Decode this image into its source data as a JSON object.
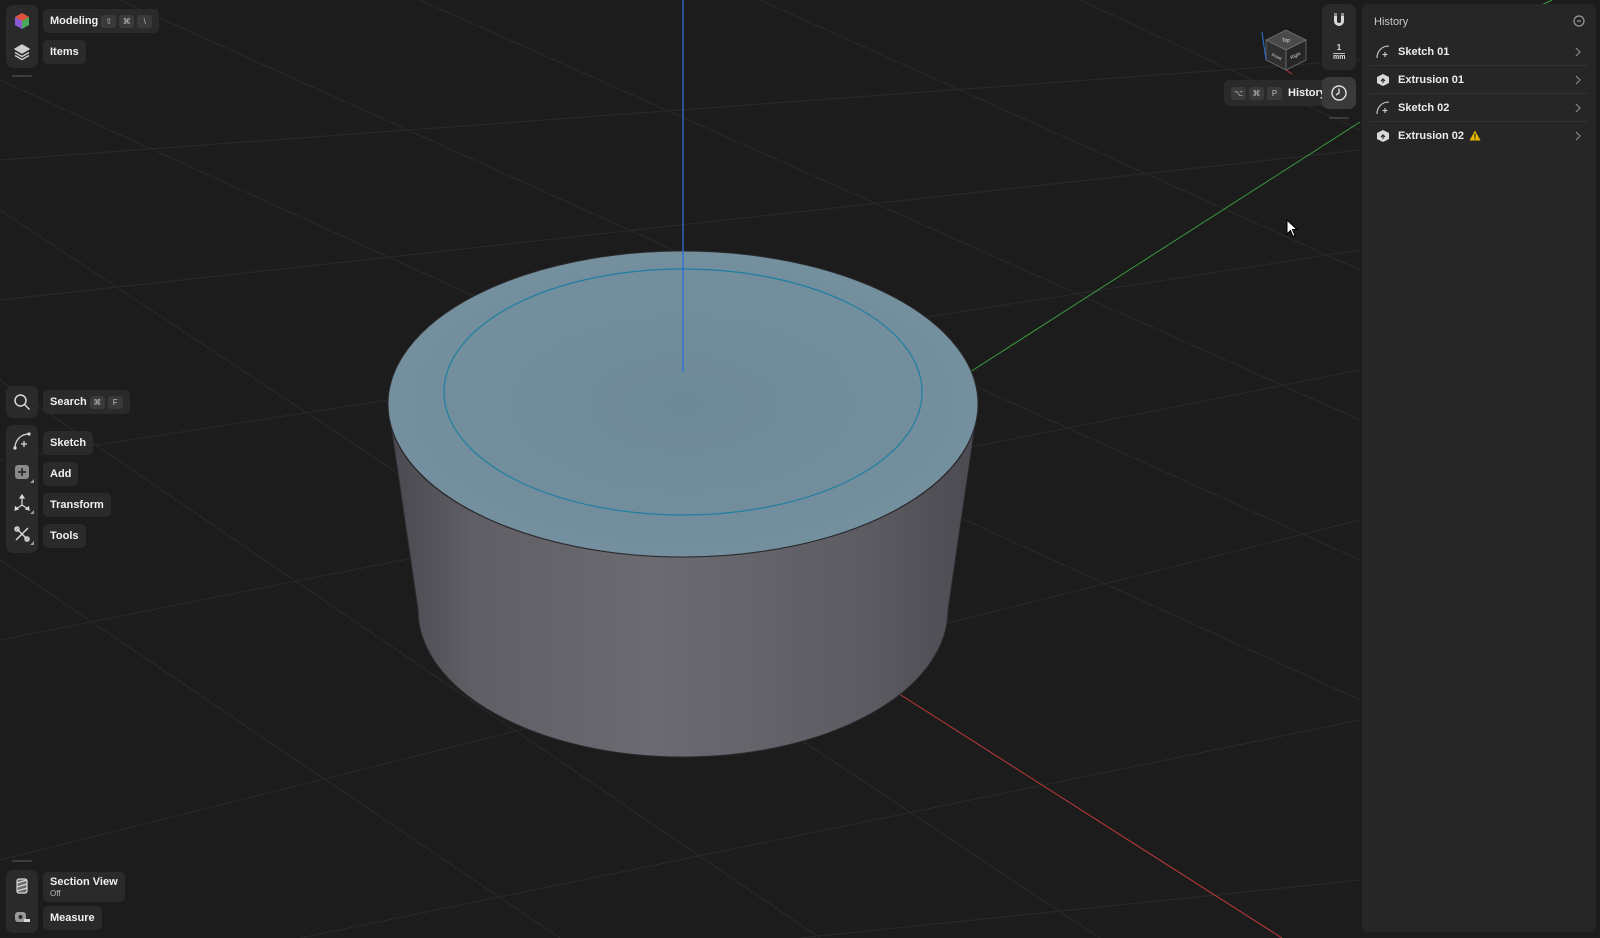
{
  "top_left": {
    "workspace_label": "Modeling",
    "workspace_shortcut": [
      "⇧",
      "⌘",
      "\\"
    ],
    "items_label": "Items"
  },
  "tools": {
    "search_label": "Search",
    "search_shortcut": [
      "⌘",
      "F"
    ],
    "sketch_label": "Sketch",
    "add_label": "Add",
    "transform_label": "Transform",
    "tools_label": "Tools"
  },
  "bottom_left": {
    "section_view_label": "Section View",
    "section_view_state": "Off",
    "measure_label": "Measure"
  },
  "view_cube": {
    "faces": [
      "Top",
      "Front",
      "Right"
    ]
  },
  "right_rail": {
    "snap_value": "1",
    "snap_unit": "mm",
    "history_shortcut": [
      "⌥",
      "⌘",
      "P"
    ],
    "history_label": "History"
  },
  "history_panel": {
    "title": "History",
    "items": [
      {
        "label": "Sketch 01",
        "icon": "sketch-icon",
        "warning": false
      },
      {
        "label": "Extrusion 01",
        "icon": "extrusion-icon",
        "warning": false
      },
      {
        "label": "Sketch 02",
        "icon": "sketch-icon",
        "warning": false
      },
      {
        "label": "Extrusion 02",
        "icon": "extrusion-icon",
        "warning": true
      }
    ]
  },
  "colors": {
    "background": "#1c1c1c",
    "panel": "#262626",
    "axis_z": "#2d6fd6",
    "axis_y": "#3c9a3c",
    "axis_x": "#c03a3a",
    "selection_face": "#6f8a96",
    "sketch_circle": "#1e7fa0",
    "warning": "#e6b800"
  }
}
